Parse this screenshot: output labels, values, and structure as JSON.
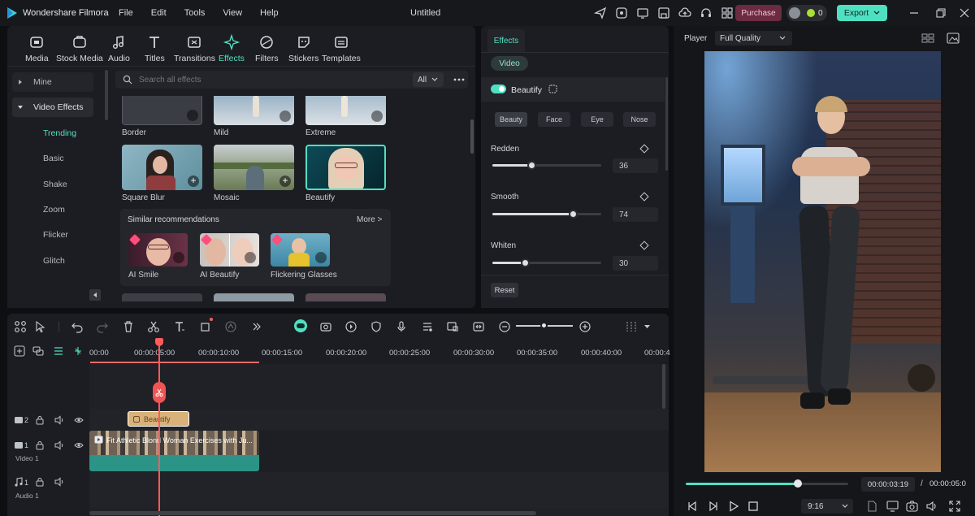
{
  "app": {
    "name": "Wondershare Filmora",
    "doc_title": "Untitled"
  },
  "menu": [
    "File",
    "Edit",
    "Tools",
    "View",
    "Help"
  ],
  "titlebar": {
    "purchase": "Purchase",
    "credits": "0",
    "export": "Export"
  },
  "tools": [
    "Media",
    "Stock Media",
    "Audio",
    "Titles",
    "Transitions",
    "Effects",
    "Filters",
    "Stickers",
    "Templates"
  ],
  "sidebar": {
    "mine": "Mine",
    "video_effects": "Video Effects",
    "subs": [
      "Trending",
      "Basic",
      "Shake",
      "Zoom",
      "Flicker",
      "Glitch"
    ]
  },
  "search": {
    "placeholder": "Search all effects",
    "filter": "All"
  },
  "effects": [
    "Border",
    "Mild",
    "Extreme",
    "Square Blur",
    "Mosaic",
    "Beautify"
  ],
  "similar": {
    "title": "Similar recommendations",
    "more": "More >",
    "items": [
      "AI Smile",
      "AI Beautify",
      "Flickering Glasses"
    ]
  },
  "props": {
    "tab": "Effects",
    "subtab": "Video",
    "effect": "Beautify",
    "segments": [
      "Beauty",
      "Face",
      "Eye",
      "Nose"
    ],
    "sliders": [
      {
        "label": "Redden",
        "value": "36",
        "level": 0.36
      },
      {
        "label": "Smooth",
        "value": "74",
        "level": 0.74
      },
      {
        "label": "Whiten",
        "value": "30",
        "level": 0.3
      }
    ],
    "reset": "Reset"
  },
  "player": {
    "label": "Player",
    "quality": "Full Quality",
    "current": "00:00:03:19",
    "total": "00:00:05:0",
    "sep": "/",
    "ratio": "9:16",
    "progress": 0.69
  },
  "timeline": {
    "ruler": [
      "00:00",
      "00:00:05:00",
      "00:00:10:00",
      "00:00:15:00",
      "00:00:20:00",
      "00:00:25:00",
      "00:00:30:00",
      "00:00:35:00",
      "00:00:40:00",
      "00:00:4"
    ],
    "tracks": {
      "t2": "2",
      "t1": "1",
      "video1": "Video 1",
      "a1": "1",
      "audio1": "Audio 1"
    },
    "effect_clip": "Beautify",
    "video_clip": "Fit Athletic Blond Woman Exercises with Ju..."
  }
}
